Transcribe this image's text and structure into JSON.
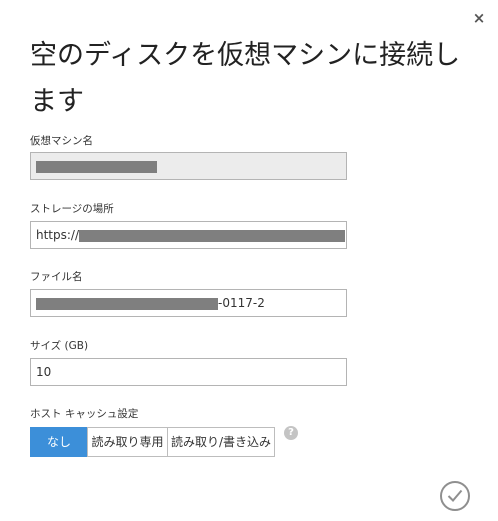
{
  "dialog": {
    "title": "空のディスクを仮想マシンに接続します",
    "close_glyph": "×"
  },
  "vm_name": {
    "label": "仮想マシン名"
  },
  "storage_location": {
    "label": "ストレージの場所",
    "value_prefix": "https://"
  },
  "file_name": {
    "label": "ファイル名",
    "value_suffix": "-0117-2"
  },
  "size": {
    "label": "サイズ (GB)",
    "value": "10"
  },
  "host_cache": {
    "label": "ホスト キャッシュ設定",
    "options": [
      "なし",
      "読み取り専用",
      "読み取り/書き込み"
    ],
    "selected": "なし",
    "help_glyph": "?"
  },
  "colors": {
    "accent": "#3c8fd9",
    "readonly_bg": "#ececec",
    "redaction": "#7f7f7f"
  },
  "icons": {
    "close": "close-icon",
    "help": "help-icon",
    "confirm": "checkmark-icon"
  }
}
